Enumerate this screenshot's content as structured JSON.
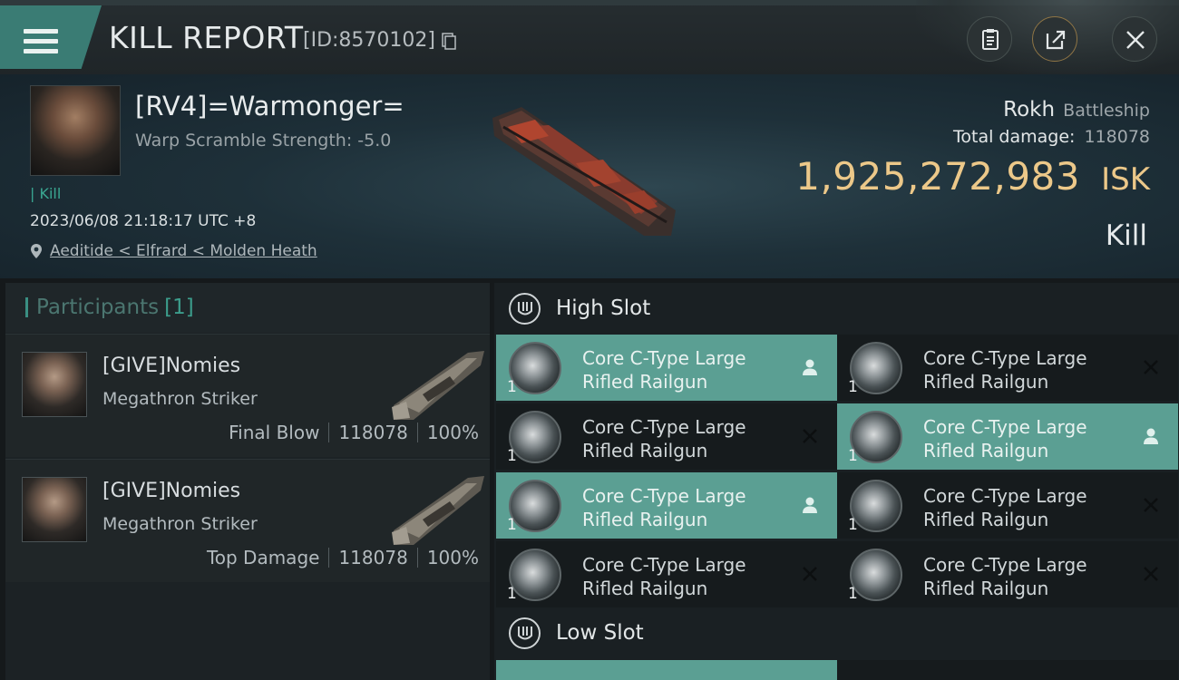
{
  "header": {
    "title": "KILL REPORT",
    "report_id": "[ID:8570102]",
    "menu_icon": "hamburger-menu-icon",
    "actions": [
      "clipboard-icon",
      "share-icon",
      "close-icon"
    ]
  },
  "victim": {
    "name": "[RV4]=Warmonger=",
    "warp_scramble": "Warp Scramble Strength: -5.0",
    "tag": "Kill",
    "datetime": "2023/06/08 21:18:17 UTC +8",
    "location": "Aeditide < Elfrard < Molden Heath",
    "ship_name": "Rokh",
    "ship_class": "Battleship",
    "total_damage_label": "Total damage:",
    "total_damage": "118078",
    "isk_value": "1,925,272,983",
    "isk_unit": "ISK",
    "result": "Kill"
  },
  "participants": {
    "title": "Participants",
    "count": "[1]",
    "items": [
      {
        "name": "[GIVE]Nomies",
        "ship": "Megathron Striker",
        "role": "Final Blow",
        "damage": "118078",
        "percent": "100%"
      },
      {
        "name": "[GIVE]Nomies",
        "ship": "Megathron Striker",
        "role": "Top Damage",
        "damage": "118078",
        "percent": "100%"
      }
    ]
  },
  "fittings": {
    "high_slot_title": "High Slot",
    "low_slot_title": "Low Slot",
    "high_slot_modules": [
      {
        "line1": "Core C-Type Large",
        "line2": "Rifled Railgun",
        "qty": "1",
        "state": "teal",
        "status_icon": "person-icon"
      },
      {
        "line1": "Core C-Type Large",
        "line2": "Rifled Railgun",
        "qty": "1",
        "state": "dark",
        "status_icon": "destroyed-x-icon"
      },
      {
        "line1": "Core C-Type Large",
        "line2": "Rifled Railgun",
        "qty": "1",
        "state": "dark",
        "status_icon": "destroyed-x-icon"
      },
      {
        "line1": "Core C-Type Large",
        "line2": "Rifled Railgun",
        "qty": "1",
        "state": "teal",
        "status_icon": "person-icon"
      },
      {
        "line1": "Core C-Type Large",
        "line2": "Rifled Railgun",
        "qty": "1",
        "state": "teal",
        "status_icon": "person-icon"
      },
      {
        "line1": "Core C-Type Large",
        "line2": "Rifled Railgun",
        "qty": "1",
        "state": "dark",
        "status_icon": "destroyed-x-icon"
      },
      {
        "line1": "Core C-Type Large",
        "line2": "Rifled Railgun",
        "qty": "1",
        "state": "dark",
        "status_icon": "destroyed-x-icon"
      },
      {
        "line1": "Core C-Type Large",
        "line2": "Rifled Railgun",
        "qty": "1",
        "state": "dark",
        "status_icon": "destroyed-x-icon"
      }
    ]
  },
  "colors": {
    "accent_teal": "#5b9f93",
    "isk_gold": "#ecc889",
    "kill_green": "#3aa792"
  }
}
